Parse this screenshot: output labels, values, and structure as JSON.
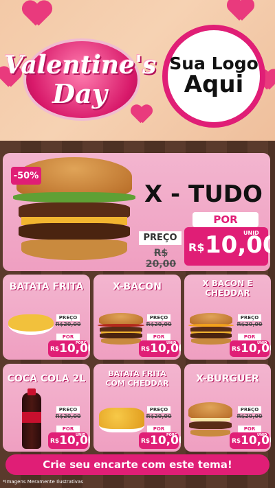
{
  "header": {
    "title_line1": "Valentine's",
    "title_line2": "Day",
    "logo_line1": "Sua Logo",
    "logo_line2": "Aqui"
  },
  "hero": {
    "badge": "-50%",
    "name": "X - TUDO",
    "preco_label": "PREÇO",
    "old_price": "R$ 20,00",
    "por_label": "POR",
    "currency": "R$",
    "price": "10,00",
    "unit": "UNID"
  },
  "items": [
    {
      "name": "BATATA FRITA",
      "preco_label": "PREÇO",
      "old_price": "R$20,00",
      "por_label": "POR",
      "currency": "R$",
      "price": "10,00",
      "unit": "PORÇ"
    },
    {
      "name": "X-BACON",
      "preco_label": "PREÇO",
      "old_price": "R$20,00",
      "por_label": "POR",
      "currency": "R$",
      "price": "10,00",
      "unit": "UNID"
    },
    {
      "name": "X BACON E CHEDDAR",
      "preco_label": "PREÇO",
      "old_price": "R$20,00",
      "por_label": "POR",
      "currency": "R$",
      "price": "10,00",
      "unit": "UNID"
    },
    {
      "name": "COCA COLA 2L",
      "preco_label": "PREÇO",
      "old_price": "R$20,00",
      "por_label": "POR",
      "currency": "R$",
      "price": "10,00",
      "unit": "UNID"
    },
    {
      "name": "BATATA FRITA COM CHEDDAR",
      "preco_label": "PREÇO",
      "old_price": "R$20,00",
      "por_label": "POR",
      "currency": "R$",
      "price": "10,00",
      "unit": "PORÇ"
    },
    {
      "name": "X-BURGUER",
      "preco_label": "PREÇO",
      "old_price": "R$20,00",
      "por_label": "POR",
      "currency": "R$",
      "price": "10,00",
      "unit": "UNID"
    }
  ],
  "footer": {
    "cta": "Crie seu encarte com este tema!",
    "note": "*Imagens Meramente Ilustrativas"
  },
  "colors": {
    "accent": "#e01e76",
    "card": "#f3b5cf",
    "wood": "#4d3124"
  }
}
